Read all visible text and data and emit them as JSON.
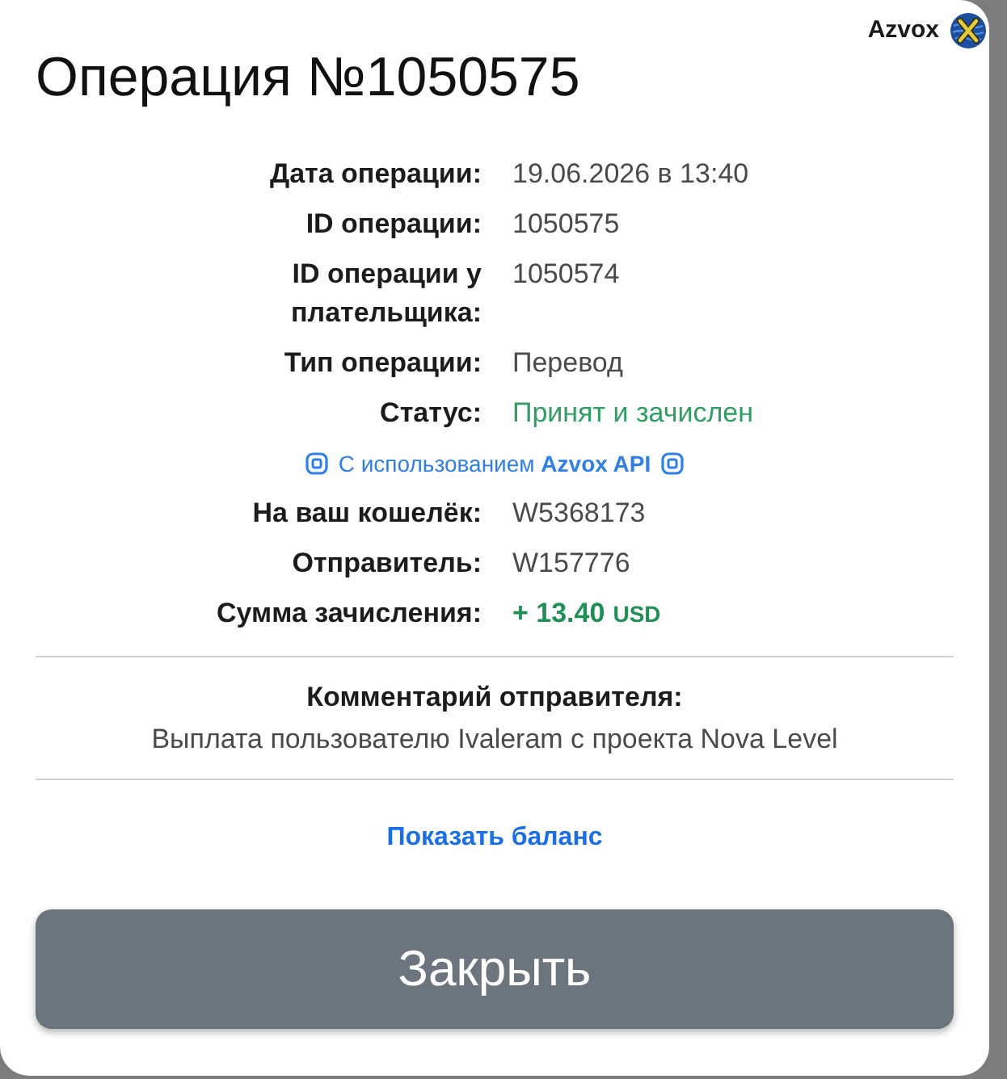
{
  "brand": {
    "name": "Azvox"
  },
  "title": "Операция №1050575",
  "details": [
    {
      "kind": "field",
      "label": "Дата операции:",
      "value": "19.06.2026 в 13:40"
    },
    {
      "kind": "field",
      "label": "ID операции:",
      "value": "1050575"
    },
    {
      "kind": "field",
      "label": "ID операции у плательщика:",
      "value": "1050574"
    },
    {
      "kind": "field",
      "label": "Тип операции:",
      "value": "Перевод"
    },
    {
      "kind": "status",
      "label": "Статус:",
      "value": "Принят и зачислен"
    },
    {
      "kind": "note",
      "text": "С использованием **Azvox API**"
    },
    {
      "kind": "field",
      "label": "На ваш кошелёк:",
      "value": "W5368173"
    },
    {
      "kind": "field",
      "label": "Отправитель:",
      "value": "W157776"
    },
    {
      "kind": "amount",
      "label": "Сумма зачисления:",
      "value": "+ 13.40",
      "currency": "USD"
    }
  ],
  "comment": {
    "heading": "Комментарий отправителя:",
    "text": "Выплата пользователю Ivaleram с проекта Nova Level"
  },
  "balance_link": "Показать баланс",
  "close_button": "Закрыть"
}
